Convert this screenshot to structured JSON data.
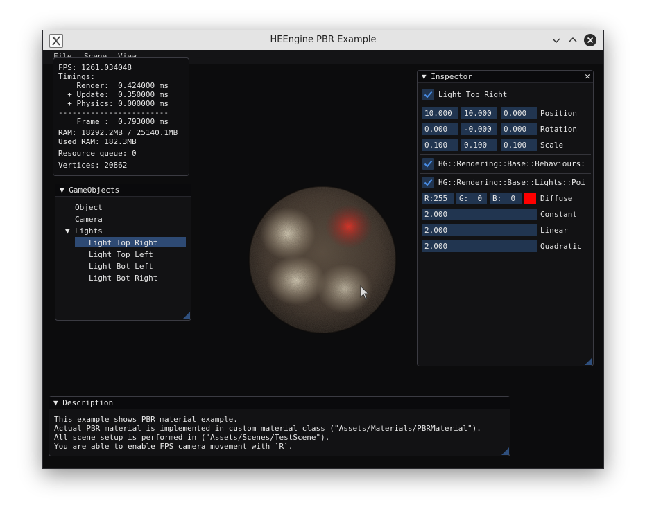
{
  "window": {
    "title": "HEEngine PBR Example"
  },
  "menu": [
    "File",
    "Scene",
    "View"
  ],
  "stats": {
    "fps": "FPS: 1261.034048",
    "timings": "Timings:",
    "render": "    Render:  0.424000 ms",
    "update": "  + Update:  0.350000 ms",
    "physics": "  + Physics: 0.000000 ms",
    "separator": "------------------------",
    "frame": "    Frame :  0.793000 ms",
    "ram": "RAM: 18292.2MB / 25140.1MB",
    "used_ram": "Used RAM: 182.3MB",
    "resource_queue": "Resource queue: 0",
    "vertices": "Vertices: 20862"
  },
  "gameobjects": {
    "title": "GameObjects",
    "items": [
      "Object",
      "Camera"
    ],
    "lights_label": "Lights",
    "lights": [
      "Light Top Right",
      "Light Top Left",
      "Light Bot Left",
      "Light Bot Right"
    ]
  },
  "inspector": {
    "title": "Inspector",
    "object_name": "Light Top Right",
    "position": {
      "label": "Position",
      "x": "10.000",
      "y": "10.000",
      "z": "0.000"
    },
    "rotation": {
      "label": "Rotation",
      "x": "0.000",
      "y": "-0.000",
      "z": "0.000"
    },
    "scale": {
      "label": "Scale",
      "x": "0.100",
      "y": "0.100",
      "z": "0.100"
    },
    "behaviours": "HG::Rendering::Base::Behaviours:",
    "pointlight": "HG::Rendering::Base::Lights::Poi",
    "diffuse": {
      "r": "R:255",
      "g": "G:  0",
      "b": "B:  0",
      "label": "Diffuse",
      "color": "#ff0000"
    },
    "constant": {
      "value": "2.000",
      "label": "Constant"
    },
    "linear": {
      "value": "2.000",
      "label": "Linear"
    },
    "quadratic": {
      "value": "2.000",
      "label": "Quadratic"
    }
  },
  "description": {
    "title": "Description",
    "lines": [
      "This example shows PBR material example.",
      "Actual PBR material is implemented in custom material class (\"Assets/Materials/PBRMaterial\").",
      "All scene setup is performed in (\"Assets/Scenes/TestScene\").",
      "You are able to enable FPS camera movement with `R`."
    ]
  },
  "colors": {
    "accent": "#4a8fe8",
    "frame_bg": "#213550",
    "selected": "#2e4a74"
  }
}
